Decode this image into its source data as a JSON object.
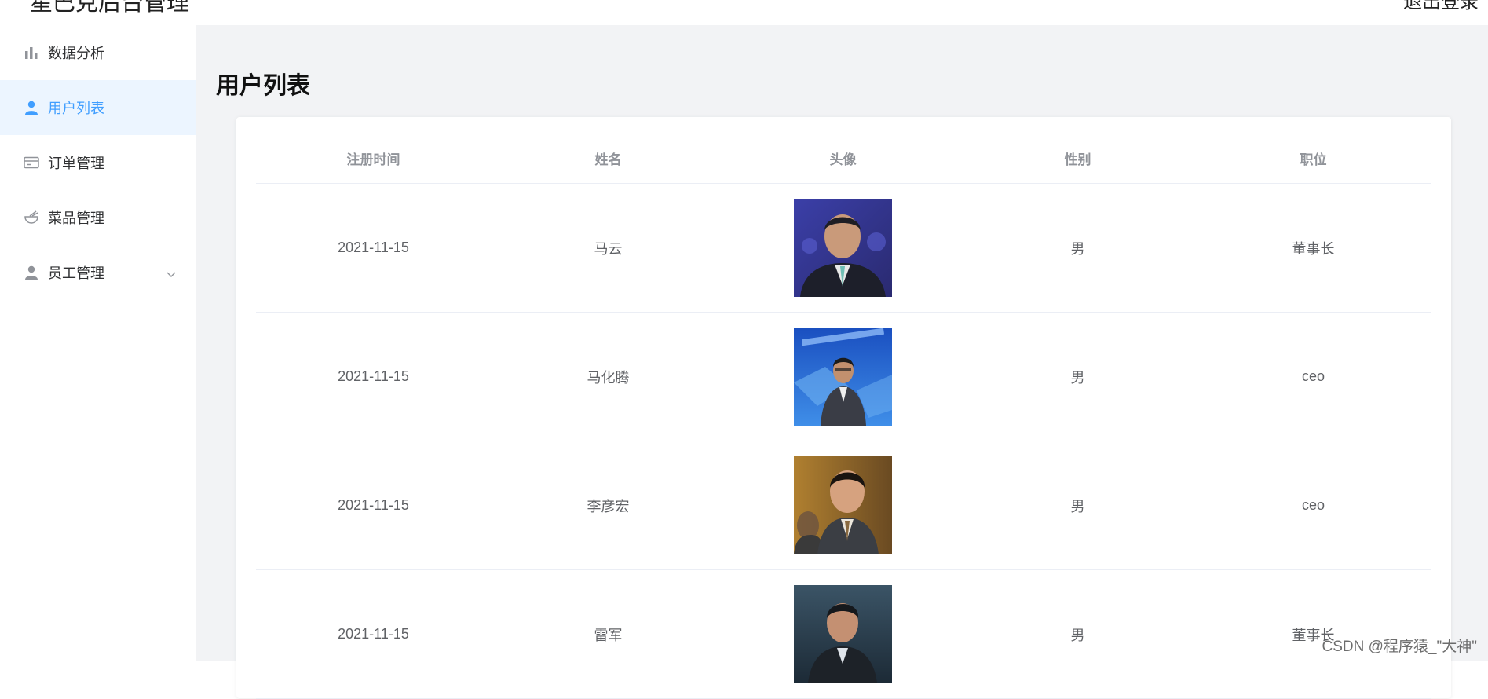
{
  "header": {
    "title": "星巴克后台管理",
    "logout_label": "退出登录"
  },
  "sidebar": {
    "items": [
      {
        "label": "数据分析",
        "icon": "bar-chart-icon",
        "active": false
      },
      {
        "label": "用户列表",
        "icon": "user-icon",
        "active": true
      },
      {
        "label": "订单管理",
        "icon": "credit-card-icon",
        "active": false
      },
      {
        "label": "菜品管理",
        "icon": "bowl-icon",
        "active": false
      },
      {
        "label": "员工管理",
        "icon": "user-icon",
        "active": false,
        "expandable": true
      }
    ]
  },
  "main": {
    "title": "用户列表",
    "table": {
      "columns": [
        "注册时间",
        "姓名",
        "头像",
        "性别",
        "职位"
      ],
      "rows": [
        {
          "date": "2021-11-15",
          "name": "马云",
          "gender": "男",
          "position": "董事长"
        },
        {
          "date": "2021-11-15",
          "name": "马化腾",
          "gender": "男",
          "position": "ceo"
        },
        {
          "date": "2021-11-15",
          "name": "李彦宏",
          "gender": "男",
          "position": "ceo"
        },
        {
          "date": "2021-11-15",
          "name": "雷军",
          "gender": "男",
          "position": "董事长"
        }
      ]
    }
  },
  "watermark": "CSDN @程序猿_\"大神\"",
  "colors": {
    "accent": "#409eff",
    "active_bg": "#ecf5ff",
    "main_bg": "#f2f3f5",
    "header_text": "#909399",
    "cell_text": "#606266"
  }
}
